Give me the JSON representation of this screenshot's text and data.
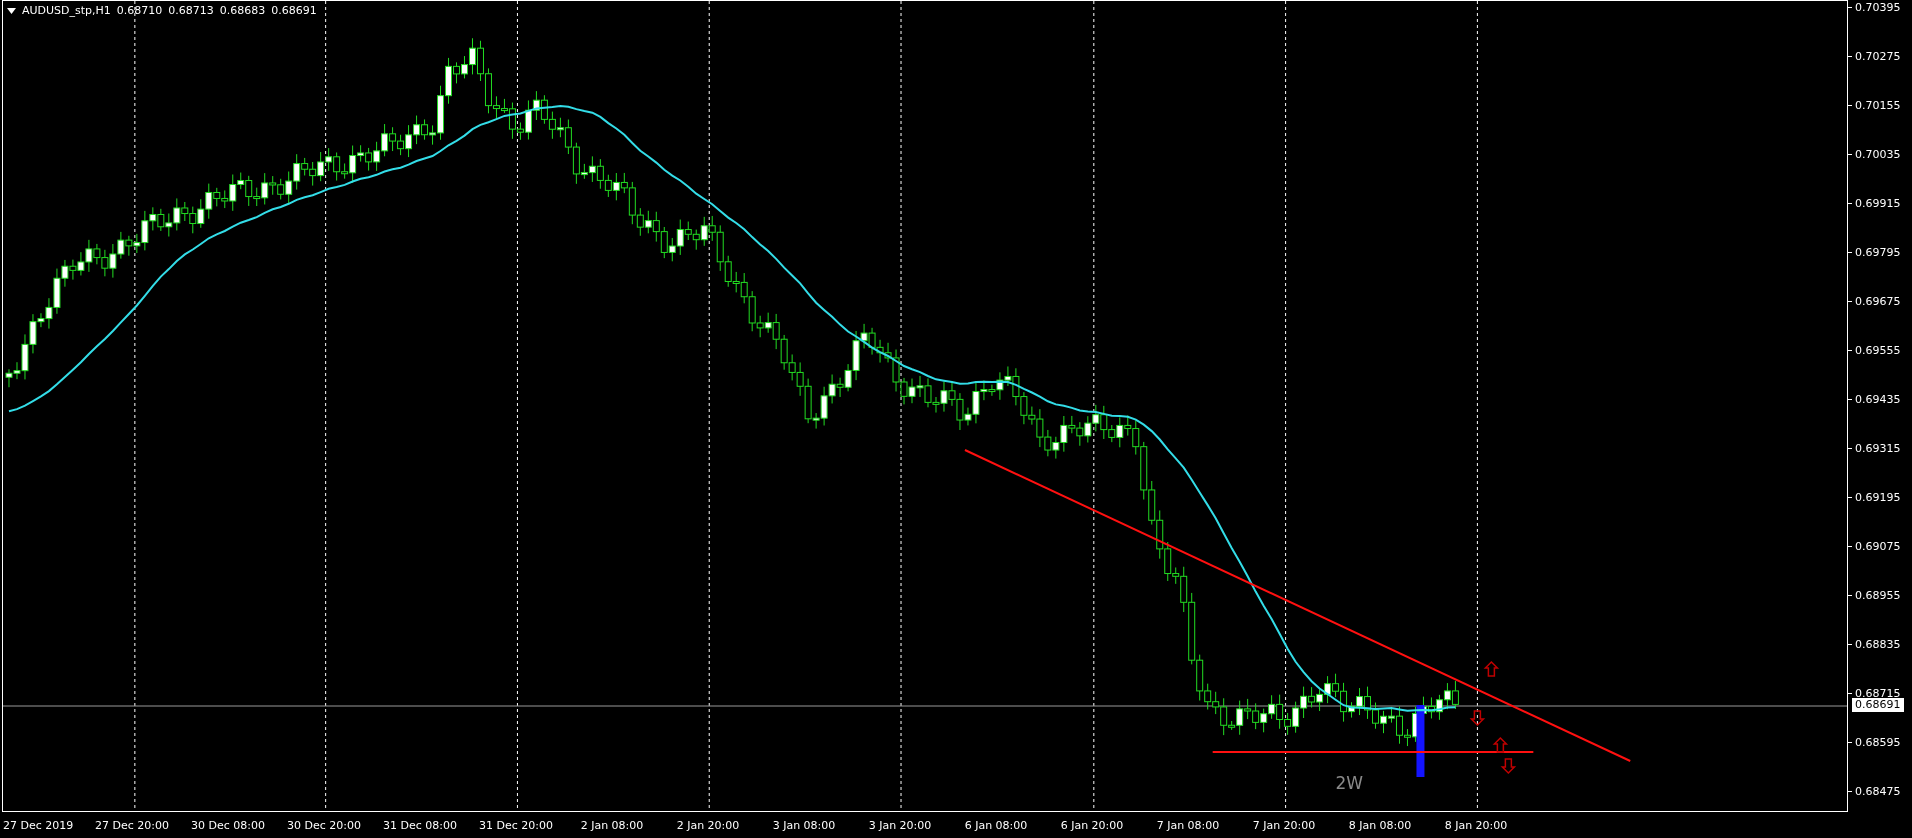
{
  "header": {
    "symbol": "AUDUSD_stp,H1",
    "prices": [
      "0.68710",
      "0.68713",
      "0.68683",
      "0.68691"
    ]
  },
  "price_axis": {
    "ticks": [
      "0.70395",
      "0.70275",
      "0.70155",
      "0.70035",
      "0.69915",
      "0.69795",
      "0.69675",
      "0.69555",
      "0.69435",
      "0.69315",
      "0.69195",
      "0.69075",
      "0.68955",
      "0.68835",
      "0.68715",
      "0.68595",
      "0.68475"
    ],
    "current_price": "0.68691"
  },
  "time_axis": {
    "labels": [
      "27 Dec 2019",
      "27 Dec 20:00",
      "30 Dec 08:00",
      "30 Dec 20:00",
      "31 Dec 08:00",
      "31 Dec 20:00",
      "2 Jan 08:00",
      "2 Jan 20:00",
      "3 Jan 08:00",
      "3 Jan 20:00",
      "6 Jan 08:00",
      "6 Jan 20:00",
      "7 Jan 08:00",
      "7 Jan 20:00",
      "8 Jan 08:00",
      "8 Jan 20:00"
    ]
  },
  "chart_label": "2W"
}
